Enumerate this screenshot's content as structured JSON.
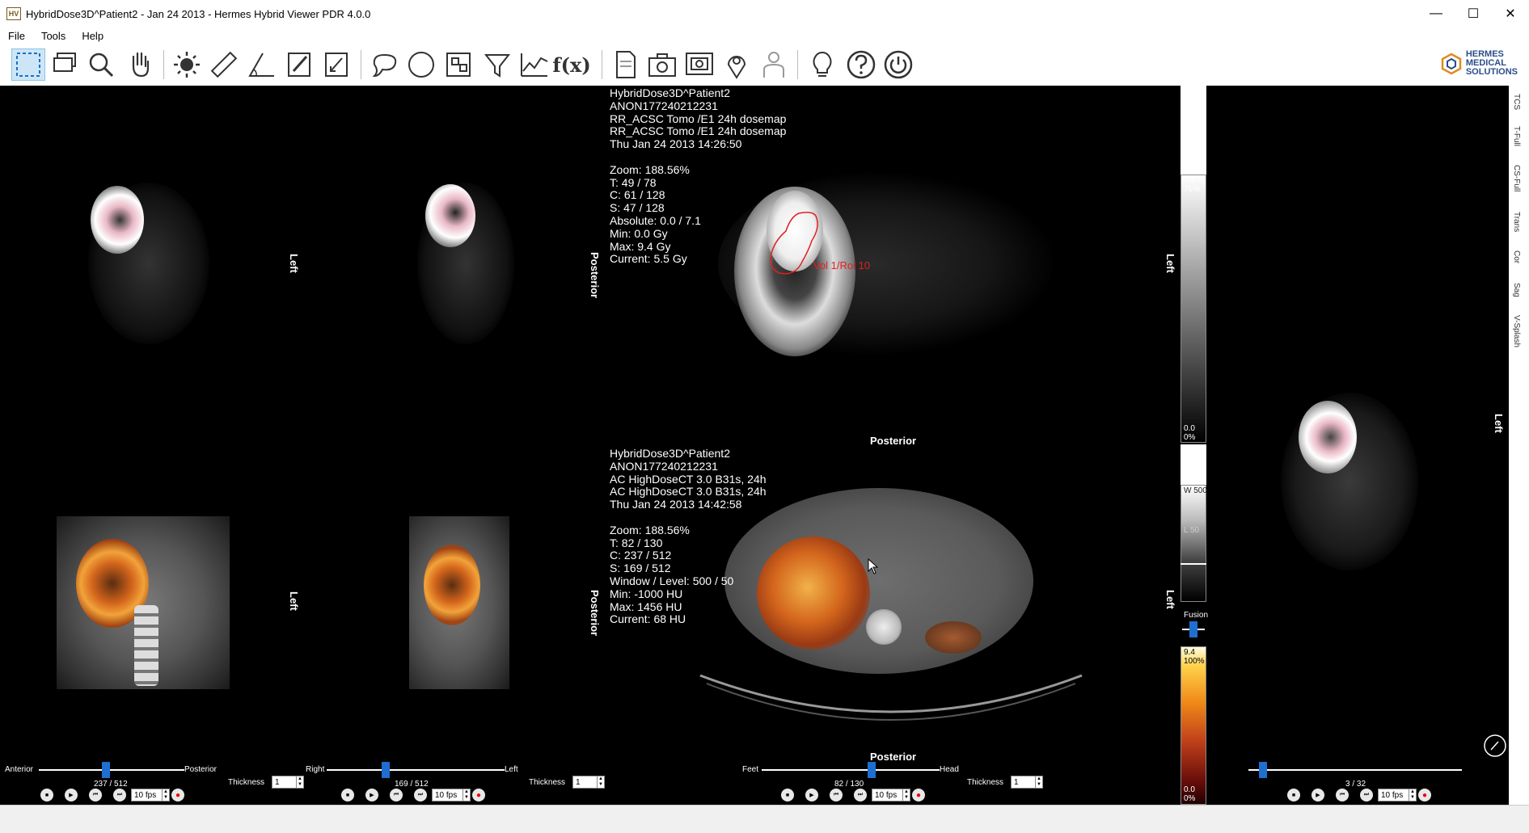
{
  "window": {
    "title": "HybridDose3D^Patient2 - Jan 24 2013 - Hermes Hybrid Viewer PDR 4.0.0",
    "app_icon": "HV",
    "minimize": "—",
    "maximize": "☐",
    "close": "✕"
  },
  "menu": {
    "file": "File",
    "tools": "Tools",
    "help": "Help"
  },
  "toolbar": {
    "fx_label": "f(x)"
  },
  "logo": {
    "line1": "HERMES",
    "line2": "MEDICAL",
    "line3": "SOLUTIONS"
  },
  "top_overlay": {
    "line1": "HybridDose3D^Patient2",
    "line2": "ANON177240212231",
    "line3": "RR_ACSC Tomo /E1 24h dosemap",
    "line4": "RR_ACSC Tomo /E1 24h dosemap",
    "line5": "Thu Jan 24 2013 14:26:50",
    "line6": "Zoom: 188.56%",
    "line7": "T: 49 / 78",
    "line8": "C: 61 / 128",
    "line9": "S: 47 / 128",
    "line10": "Absolute: 0.0 / 7.1",
    "line11": "Min: 0.0 Gy",
    "line12": "Max: 9.4 Gy",
    "line13": "Current: 5.5 Gy"
  },
  "bottom_overlay": {
    "line1": "HybridDose3D^Patient2",
    "line2": "ANON177240212231",
    "line3": "AC HighDoseCT 3.0 B31s, 24h",
    "line4": "AC HighDoseCT 3.0 B31s, 24h",
    "line5": "Thu Jan 24 2013 14:42:58",
    "line6": "Zoom: 188.56%",
    "line7": "T: 82 / 130",
    "line8": "C: 237 / 512",
    "line9": "S: 169 / 512",
    "line10": "Window / Level: 500 / 50",
    "line11": "Min: -1000 HU",
    "line12": "Max: 1456 HU",
    "line13": "Current: 68 HU"
  },
  "roi_label": "Vol 1/Roi 10",
  "orientations": {
    "left": "Left",
    "posterior": "Posterior",
    "anterior": "Anterior",
    "right": "Right",
    "feet": "Feet",
    "head": "Head"
  },
  "colorbar": {
    "top_value": "7.1",
    "top_pct": "76%",
    "gray_bottom_value": "0.0",
    "gray_bottom_pct": "0%",
    "window": "W 500",
    "level": "L 50",
    "fusion": "Fusion",
    "fusion_level": 0.5,
    "hot_top_value": "9.4",
    "hot_top_pct": "100%",
    "hot_bottom_value": "0.0",
    "hot_bottom_pct": "0%"
  },
  "side_tabs": [
    "TCS",
    "T-Full",
    "CS-Full",
    "Trans",
    "Cor",
    "Sag",
    "V-Splash"
  ],
  "controls": {
    "coronal": {
      "start": "Anterior",
      "end": "Posterior",
      "counter": "237 / 512",
      "position": 0.46,
      "fps": "10 fps"
    },
    "sagittal": {
      "start": "Right",
      "end": "Left",
      "counter": "169 / 512",
      "position": 0.33,
      "fps": "10 fps"
    },
    "transverse": {
      "start": "Feet",
      "end": "Head",
      "counter": "82 / 130",
      "position": 0.62,
      "fps": "10 fps"
    },
    "mip": {
      "counter": "3 / 32",
      "position": 0.07,
      "fps": "10 fps"
    },
    "thickness_label": "Thickness",
    "thickness_value": "1"
  },
  "colors": {
    "roi": "#e02020",
    "slider": "#1e6fd0",
    "accent_toolbar": "#cde6f7"
  }
}
